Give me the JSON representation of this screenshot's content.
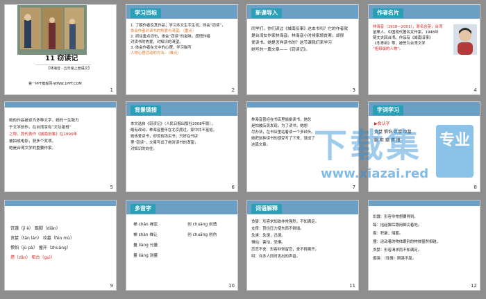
{
  "colors": {
    "page_bg": "#8e8e8e",
    "topbar": "#6c9fc4",
    "accent_red": "#d7261e",
    "accent_orange": "#e0762b",
    "watermark": "#2b8fd6"
  },
  "slides": [
    {
      "num": "1",
      "title": "11 窃读记",
      "author": "【林海音 · 五年级上册语文】",
      "footer": "第一PPT模板网-WWW.1PPT.COM"
    },
    {
      "num": "2",
      "tab": "学习目标",
      "lines": [
        "1. 了解作者及其作品；学习本文生字生词；体会“窃读”，",
        "体会作者对读书的热爱与渴望。（重点）",
        "2. 抓住重点词句，体会“窃读”的滋味，感悟作者",
        "对读书的热爱，对知识的渴望。",
        "3. 体会作者在文中的心理，学习描写",
        "人物心理活动的方法。（难点）"
      ]
    },
    {
      "num": "3",
      "tab": "新课导入",
      "lines": [
        "同学们，你们读过《城南旧事》这本书吗？它的作者就",
        "是台湾女作家林海音。林海音小时候家境贫寒，却很",
        "爱读书。她是怎样读书的？这节课我们来学习",
        "她写的一篇文章——《窃读记》。"
      ]
    },
    {
      "num": "4",
      "tab": "作者名片",
      "lines": [
        "林海音（1918—2001），原名含英，台湾",
        "苗栗人。中国现代著名女作家。1948年",
        "随丈夫回台湾。作品有《城南旧事》",
        "《冬青树》等，被誉为台湾文学",
        "“祖母级的人物”。"
      ]
    },
    {
      "num": "5",
      "lines": [
        "她的作品被译为多种文字，她的一生致力",
        "于文学创作。在台湾享有“文坛祖母”",
        "之称。其代表作《城南旧事》在1990年",
        "被拍成电影，获多个奖项。",
        "她是台湾文学的重要作家。"
      ]
    },
    {
      "num": "6",
      "tab": "背景链接",
      "lines": [
        "本文选自《窃读记》（人民日报出版社2008年版），",
        "略有改动。林海音童年在北京度过，家中并不富裕，",
        "她热爱读书，却没有钱买书，只好在书店",
        "里“窃读”。文章写出了她对读书的渴望，",
        "对知识的向往。"
      ]
    },
    {
      "num": "7",
      "lines": [
        "林海音曾经在书店里偷偷读书，她总",
        "是怕被店员发现。为了读书，她想",
        "尽办法，在书店里站着读一个多钟头。",
        "她把这种读书的感受写了下来，就成了",
        "这篇文章。"
      ]
    },
    {
      "num": "8",
      "tab": "字词学习",
      "lines": [
        "▶会认字",
        "贪婪 惧怕 饥饿 坟墓",
        "腿 柜 踮 攒 撞"
      ]
    },
    {
      "num": "9",
      "lines": [
        "饥饿（jī è） 踮脚（diǎn）",
        "贪婪（tān lán） 坟墓（fén mù）",
        "惧怕（jù pà） 撞开（zhuàng）",
        "攒（zǎn） 柜台（guì）"
      ]
    },
    {
      "num": "10",
      "tab": "多音字",
      "lines": [
        "禅 chán 禅定",
        "禅 shàn 禅让",
        "创 chuàng 创造",
        "创 chuāng 创伤",
        "量 liàng 分量",
        "量 liáng 测量"
      ]
    },
    {
      "num": "11",
      "tab": "词语解释",
      "lines": [
        "贪婪：形容求知欲非常强烈，不知满足。",
        "支撑：顶住压力使东西不倒塌。",
        "急遽：急速，迅速。",
        "惧怕：害怕，恐惧。",
        "恋恋不舍：形容非常留恋，舍不得离开。",
        "哄：许多人同时发出的声音。"
      ]
    },
    {
      "num": "12",
      "lines": [
        "饥饿：形容非常想要得到。",
        "踮：抬起脚后跟用脚尖着地。",
        "攒：积聚；储蓄。",
        "撞：运动着的物体跟别的物体猛然相碰。",
        "贪婪：形容渴求而不知满足。",
        "倔强：（性情）刚强不屈。"
      ]
    }
  ],
  "watermark": {
    "text_main": "下载集",
    "text_side": "专业",
    "url": "www.xiazai.red"
  }
}
